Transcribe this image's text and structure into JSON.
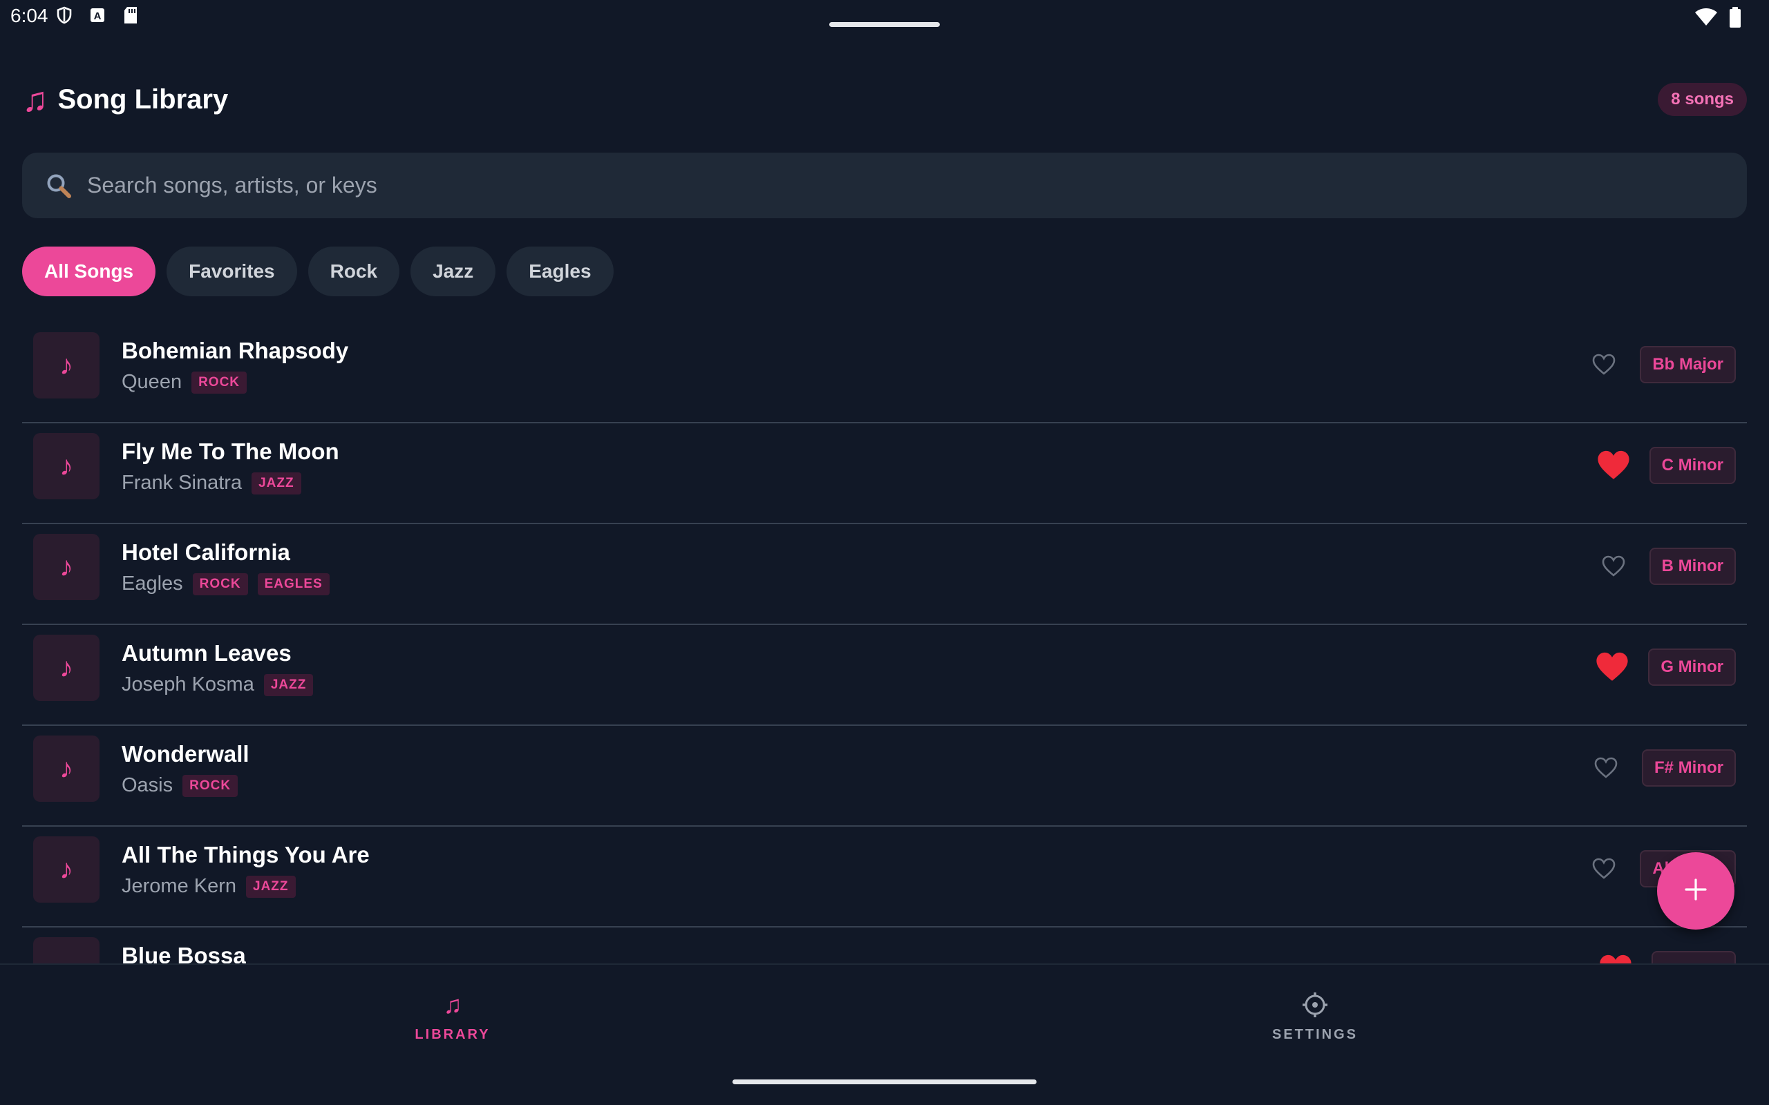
{
  "status_bar": {
    "time": "6:04",
    "icons_left": [
      "shield-icon",
      "a-icon",
      "sd-card-icon"
    ],
    "icons_right": [
      "wifi-icon",
      "battery-icon"
    ]
  },
  "header": {
    "icon": "music-note-icon",
    "title": "Song Library",
    "count": "8 songs"
  },
  "search": {
    "icon": "search-icon",
    "placeholder": "Search songs, artists, or keys",
    "value": ""
  },
  "filters": [
    {
      "label": "All Songs",
      "active": true
    },
    {
      "label": "Favorites",
      "active": false
    },
    {
      "label": "Rock",
      "active": false
    },
    {
      "label": "Jazz",
      "active": false
    },
    {
      "label": "Eagles",
      "active": false
    }
  ],
  "songs": [
    {
      "title": "Bohemian Rhapsody",
      "artist": "Queen",
      "tags": [
        "ROCK"
      ],
      "favorite": false,
      "key": "Bb Major"
    },
    {
      "title": "Fly Me To The Moon",
      "artist": "Frank Sinatra",
      "tags": [
        "JAZZ"
      ],
      "favorite": true,
      "key": "C Minor"
    },
    {
      "title": "Hotel California",
      "artist": "Eagles",
      "tags": [
        "ROCK",
        "EAGLES"
      ],
      "favorite": false,
      "key": "B Minor"
    },
    {
      "title": "Autumn Leaves",
      "artist": "Joseph Kosma",
      "tags": [
        "JAZZ"
      ],
      "favorite": true,
      "key": "G Minor"
    },
    {
      "title": "Wonderwall",
      "artist": "Oasis",
      "tags": [
        "ROCK"
      ],
      "favorite": false,
      "key": "F# Minor"
    },
    {
      "title": "All The Things You Are",
      "artist": "Jerome Kern",
      "tags": [
        "JAZZ"
      ],
      "favorite": false,
      "key": "Ab Major"
    },
    {
      "title": "Blue Bossa",
      "artist": "",
      "tags": [],
      "favorite": true,
      "key": ""
    }
  ],
  "fab": {
    "icon": "plus-icon"
  },
  "nav": [
    {
      "label": "LIBRARY",
      "icon": "music-note-icon",
      "active": true
    },
    {
      "label": "SETTINGS",
      "icon": "gear-icon",
      "active": false
    }
  ],
  "colors": {
    "background": "#111827",
    "surface": "#1f2937",
    "accent": "#ec4899",
    "favorite": "#ef2a3a",
    "muted_text": "#9ca3af"
  }
}
